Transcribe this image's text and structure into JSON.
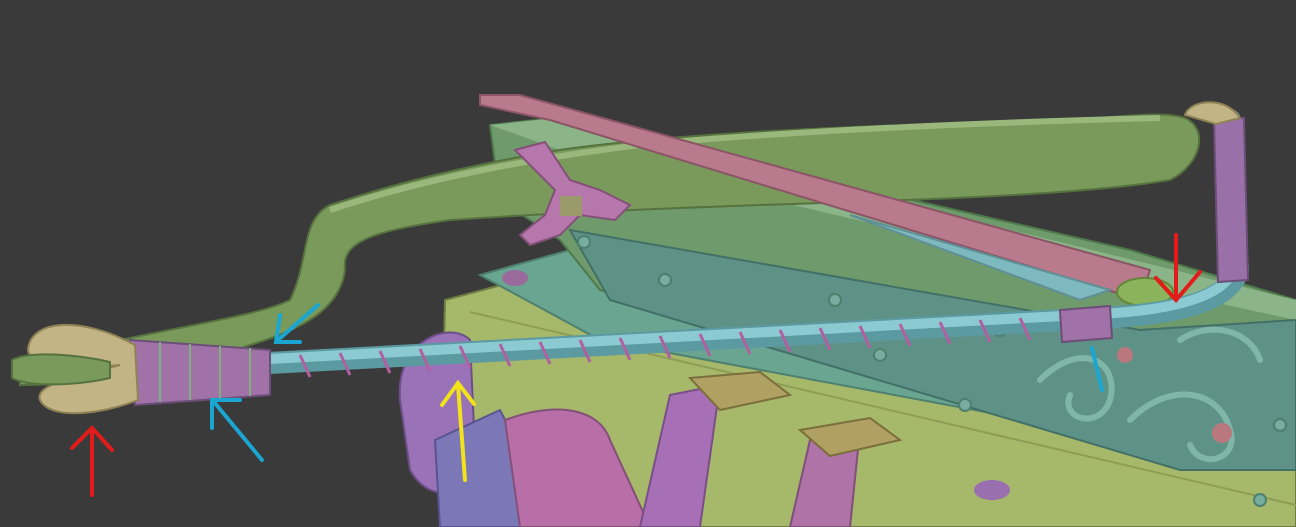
{
  "scene": {
    "background": "#3a3a3a",
    "colors": {
      "limb_green": "#7a9a5c",
      "limb_green_dark": "#5f7e46",
      "stock_green": "#6f9a6c",
      "plate_teal": "#6aa592",
      "rail_olive": "#a6b86a",
      "strap_purple": "#9a72b8",
      "strap_pink": "#b86fa8",
      "strap_blue": "#7c78b8",
      "bolt_pink": "#b87a8c",
      "string_cyan": "#7fb9c0",
      "wrap_purple": "#a072a8",
      "loop_tan": "#c2b484",
      "metal_tan": "#b09a6c",
      "arrow_red": "#e21b1b",
      "arrow_cyan": "#1aa6d0",
      "arrow_yellow": "#f2e21a"
    }
  },
  "annotations": [
    {
      "name": "red-arrow-loop",
      "color": "red",
      "direction": "up"
    },
    {
      "name": "red-arrow-bend",
      "color": "red",
      "direction": "down"
    },
    {
      "name": "cyan-arrow-limb",
      "color": "cyan",
      "direction": "down-left"
    },
    {
      "name": "cyan-arrow-wrap",
      "color": "cyan",
      "direction": "up-left"
    },
    {
      "name": "cyan-mark-right",
      "color": "cyan",
      "direction": "line"
    },
    {
      "name": "yellow-arrow-string",
      "color": "yellow",
      "direction": "up"
    }
  ]
}
